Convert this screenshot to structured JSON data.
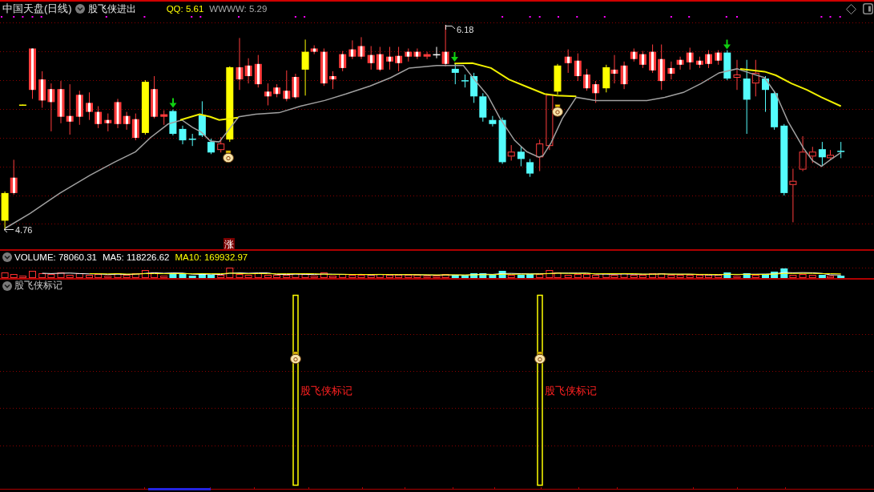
{
  "header": {
    "title": "中国天盘(日线)",
    "indicator": "股飞侠进出",
    "readouts": [
      {
        "text": "QQ: 5.61",
        "color": "#ffff00"
      },
      {
        "text": "WWWW: 5.29",
        "color": "#a8a8a8"
      }
    ]
  },
  "price_chart": {
    "high_label": "6.18",
    "low_label": "4.76",
    "badge": "涨"
  },
  "volume_panel": {
    "readouts": [
      {
        "text": "VOLUME: 78060.31",
        "color": "#ffffff"
      },
      {
        "text": "MA5: 118226.62",
        "color": "#ffffff"
      },
      {
        "text": "MA10: 169932.97",
        "color": "#ffff00"
      }
    ]
  },
  "signal_panel": {
    "title": "股飞侠标记",
    "markers": [
      {
        "label": "股飞侠标记"
      },
      {
        "label": "股飞侠标记"
      }
    ]
  }
}
